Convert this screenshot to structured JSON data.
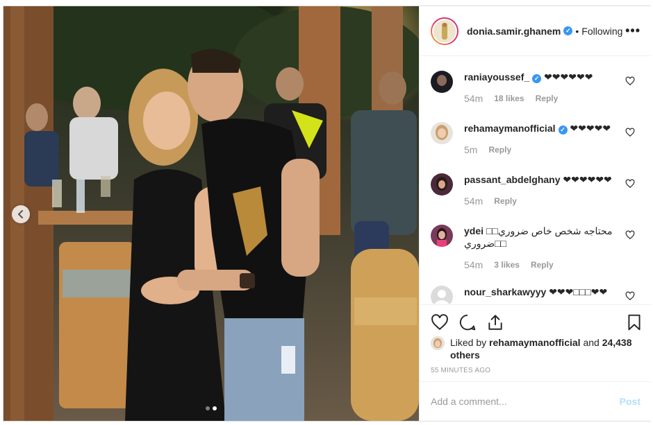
{
  "post": {
    "author": {
      "username": "donia.samir.ghanem",
      "verified": true,
      "separator": "•",
      "follow_status": "Following",
      "more_icon": "ellipsis-icon",
      "more_label": "•••"
    },
    "carousel": {
      "prev_icon": "chevron-left-icon",
      "current_index": 2,
      "total": 2
    },
    "comments": [
      {
        "username": "raniayoussef_",
        "verified": true,
        "text": "❤❤❤❤❤❤",
        "time": "54m",
        "likes": "18 likes",
        "reply_label": "Reply"
      },
      {
        "username": "rehamaymanofficial",
        "verified": true,
        "text": "❤❤❤❤❤",
        "time": "5m",
        "likes": "",
        "reply_label": "Reply"
      },
      {
        "username": "passant_abdelghany",
        "verified": false,
        "text": "❤❤❤❤❤❤",
        "time": "54m",
        "likes": "",
        "reply_label": "Reply"
      },
      {
        "username": "ydei",
        "verified": false,
        "text": "□□محتاجه شخص خاص ضروري ضروري□□",
        "time": "54m",
        "likes": "3 likes",
        "reply_label": "Reply"
      },
      {
        "username": "nour_sharkawyyy",
        "verified": false,
        "text": "❤❤❤□□□❤❤",
        "time": "",
        "likes": "",
        "reply_label": ""
      }
    ],
    "liked_by": {
      "prefix": "Liked by",
      "user": "rehamaymanofficial",
      "conj": "and",
      "others": "24,438 others"
    },
    "time_ago": "55 MINUTES AGO",
    "comment_box": {
      "placeholder": "Add a comment...",
      "post_label": "Post"
    },
    "colors": {
      "verified": "#3897f0",
      "muted": "#999999",
      "post_disabled": "#b2dffc"
    }
  }
}
